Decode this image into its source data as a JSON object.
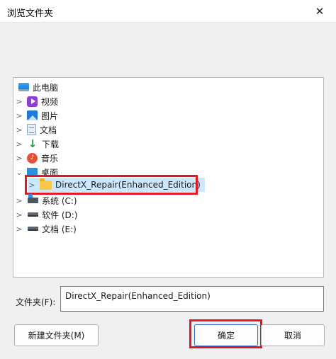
{
  "window": {
    "title": "浏览文件夹",
    "close_glyph": "✕"
  },
  "tree": {
    "root": {
      "label": "此电脑",
      "icon": "computer-icon"
    },
    "items": [
      {
        "label": "视频",
        "icon": "video-icon",
        "chevron": ">"
      },
      {
        "label": "图片",
        "icon": "picture-icon",
        "chevron": ">"
      },
      {
        "label": "文档",
        "icon": "document-icon",
        "chevron": ">"
      },
      {
        "label": "下载",
        "icon": "download-icon",
        "chevron": ">",
        "glyph": "↓"
      },
      {
        "label": "音乐",
        "icon": "music-icon",
        "chevron": ">",
        "glyph": "♪"
      },
      {
        "label": "桌面",
        "icon": "desktop-icon",
        "chevron": "⌄",
        "expanded": true
      },
      {
        "label": "DirectX_Repair(Enhanced_Edition)",
        "icon": "folder-icon",
        "chevron": ">",
        "selected": true
      },
      {
        "label": "系统 (C:)",
        "icon": "system-drive-icon",
        "chevron": ">"
      },
      {
        "label": "软件 (D:)",
        "icon": "drive-icon",
        "chevron": ">"
      },
      {
        "label": "文档 (E:)",
        "icon": "drive-icon",
        "chevron": ">"
      }
    ]
  },
  "folder_field": {
    "label": "文件夹(F):",
    "value": "DirectX_Repair(Enhanced_Edition)"
  },
  "buttons": {
    "new_folder": "新建文件夹(M)",
    "ok": "确定",
    "cancel": "取消"
  },
  "colors": {
    "highlight": "#e01823",
    "selection": "#cce8ff"
  }
}
